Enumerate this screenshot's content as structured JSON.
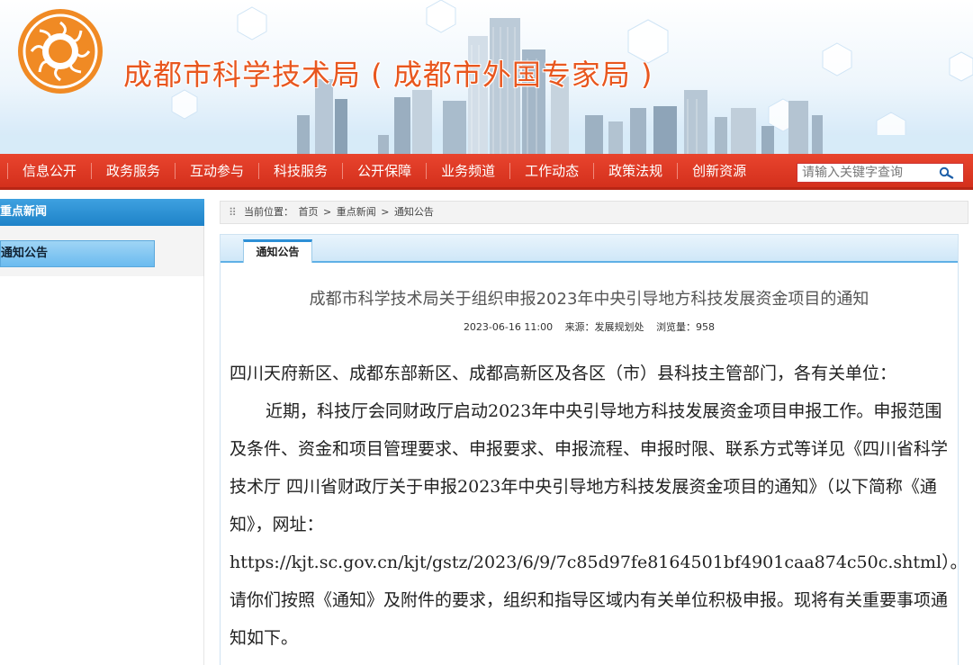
{
  "header": {
    "site_title": "成都市科学技术局 ( 成都市外国专家局 )"
  },
  "nav": {
    "items": [
      "信息公开",
      "政务服务",
      "互动参与",
      "科技服务",
      "公开保障",
      "业务频道",
      "工作动态",
      "政策法规",
      "创新资源"
    ]
  },
  "search": {
    "placeholder": "请输入关键字查询",
    "icon": "search-icon"
  },
  "sidebar": {
    "heading": "重点新闻",
    "active_item": "通知公告"
  },
  "breadcrumb": {
    "prefix": "当前位置：",
    "home": "首页",
    "sep1": ">",
    "section": "重点新闻",
    "sep2": ">",
    "current": "通知公告"
  },
  "article": {
    "tab": "通知公告",
    "title": "成都市科学技术局关于组织申报2023年中央引导地方科技发展资金项目的通知",
    "date": "2023-06-16 11:00",
    "source": "来源：发展规划处",
    "views": "浏览量：958",
    "paragraph1": "四川天府新区、成都东部新区、成都高新区及各区（市）县科技主管部门，各有关单位：",
    "paragraph2": "近期，科技厅会同财政厅启动2023年中央引导地方科技发展资金项目申报工作。申报范围及条件、资金和项目管理要求、申报要求、申报流程、申报时限、联系方式等详见《四川省科学技术厅 四川省财政厅关于申报2023年中央引导地方科技发展资金项目的通知》（以下简称《通知》，网址：https://kjt.sc.gov.cn/kjt/gstz/2023/6/9/7c85d97fe8164501bf4901caa874c50c.shtml）。请你们按照《通知》及附件的要求，组织和指导区域内有关单位积极申报。现将有关重要事项通知如下。"
  },
  "colors": {
    "nav_red": "#d4301c",
    "title_orange": "#e8571f",
    "sidebar_blue": "#1e82c8"
  }
}
